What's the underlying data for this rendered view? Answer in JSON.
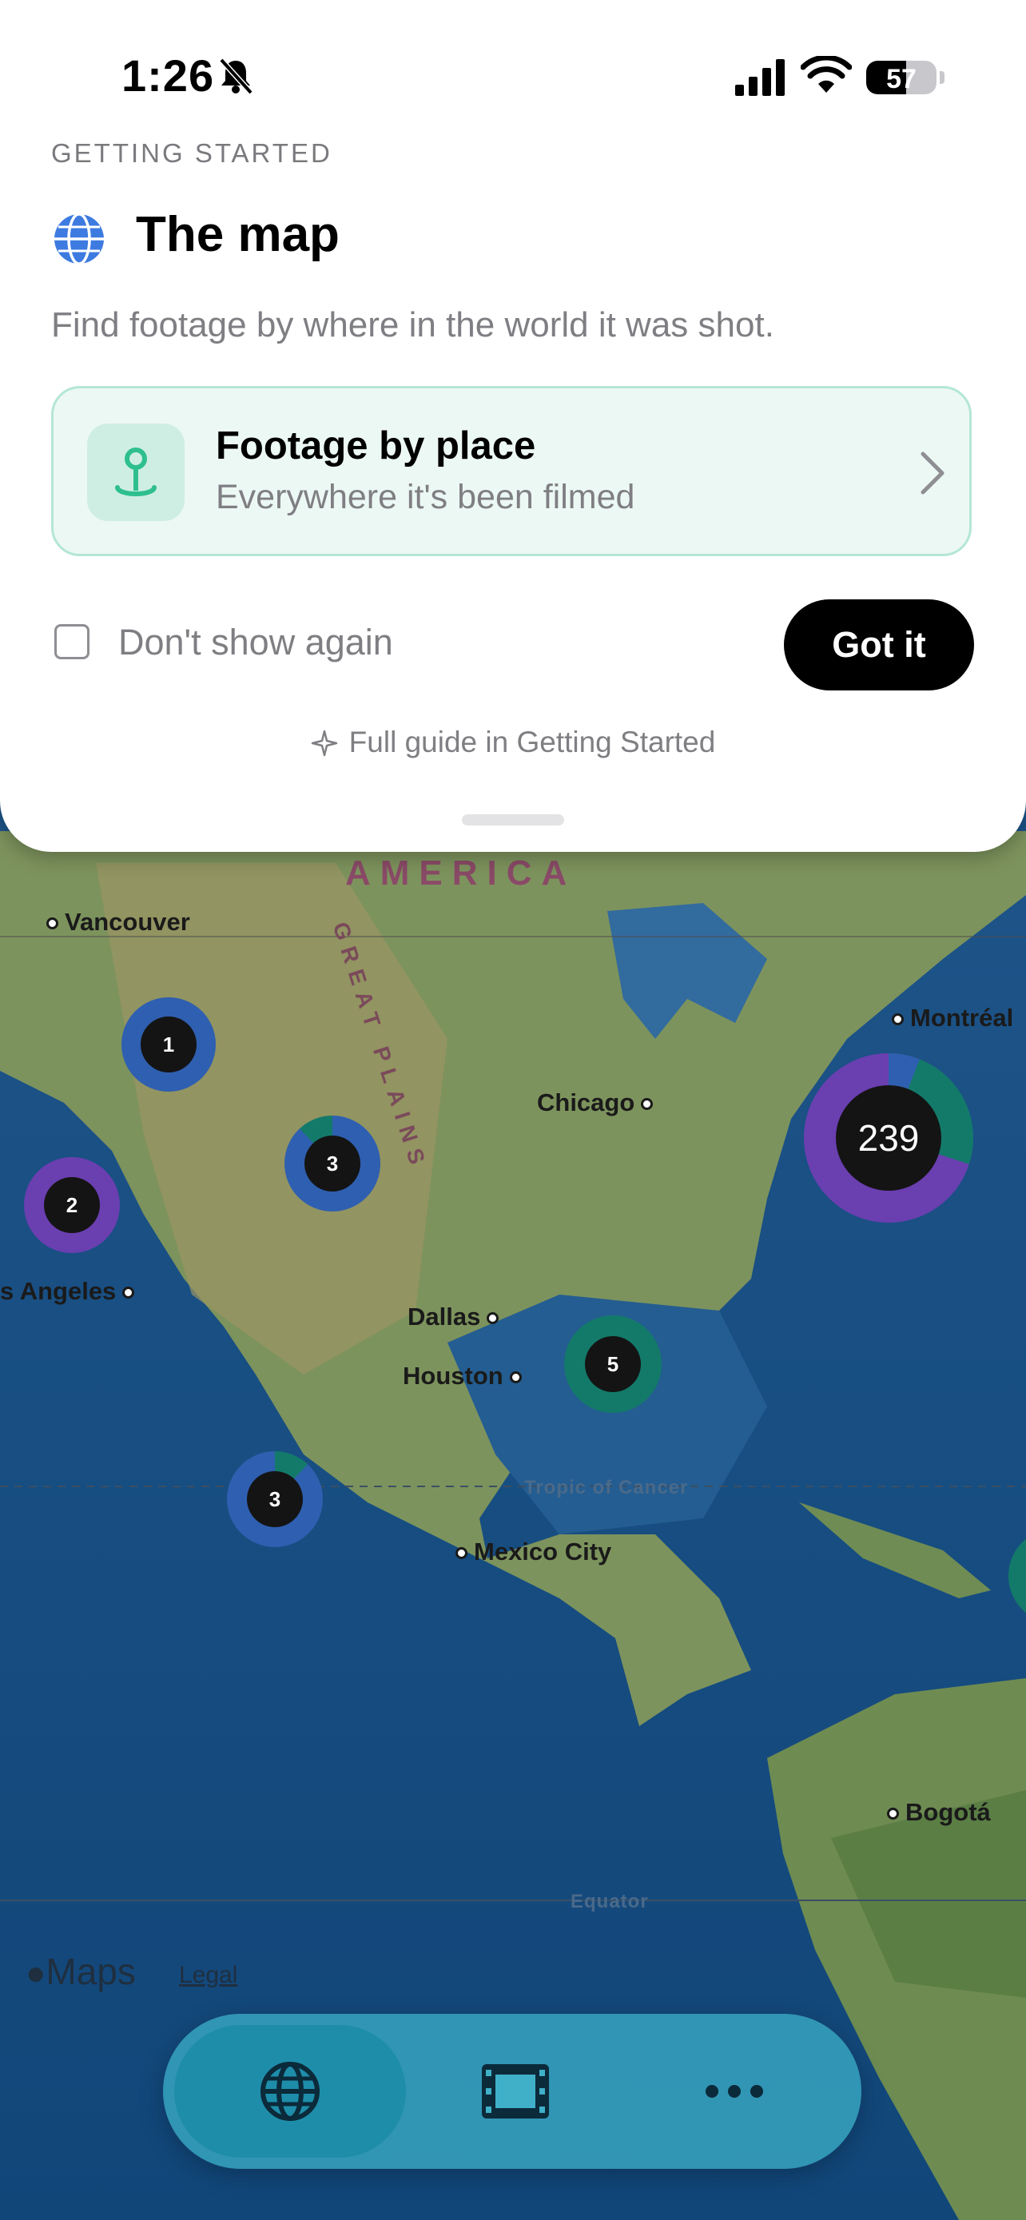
{
  "status_bar": {
    "time": "1:26",
    "battery": "57",
    "battery_level": 0.57
  },
  "sheet": {
    "kicker": "GETTING STARTED",
    "title": "The map",
    "subtitle": "Find footage by where in the world it was shot.",
    "card": {
      "title": "Footage by place",
      "subtitle": "Everywhere it's been filmed"
    },
    "checkbox_label": "Don't show again",
    "button_label": "Got it",
    "guide_link": "Full guide in Getting Started"
  },
  "map": {
    "region": "AMERICA",
    "plains": "GREAT PLAINS",
    "cities": [
      "Vancouver",
      "Montréal",
      "Chicago",
      "s Angeles",
      "Dallas",
      "Houston",
      "Mexico City",
      "Bogotá"
    ],
    "lines": [
      "Tropic of Cancer",
      "Equator"
    ],
    "clusters": [
      "1",
      "3",
      "2",
      "239",
      "5",
      "3"
    ],
    "attribution": "Maps",
    "legal": "Legal"
  },
  "colors": {
    "accent_green": "#2fbf8f",
    "cluster_blue": "#2f5fb0",
    "cluster_purple": "#6a3fb0",
    "cluster_teal": "#137a6a"
  },
  "tabbar": {
    "items": [
      "globe-icon",
      "film-icon",
      "more-icon"
    ],
    "active": "globe-icon"
  }
}
